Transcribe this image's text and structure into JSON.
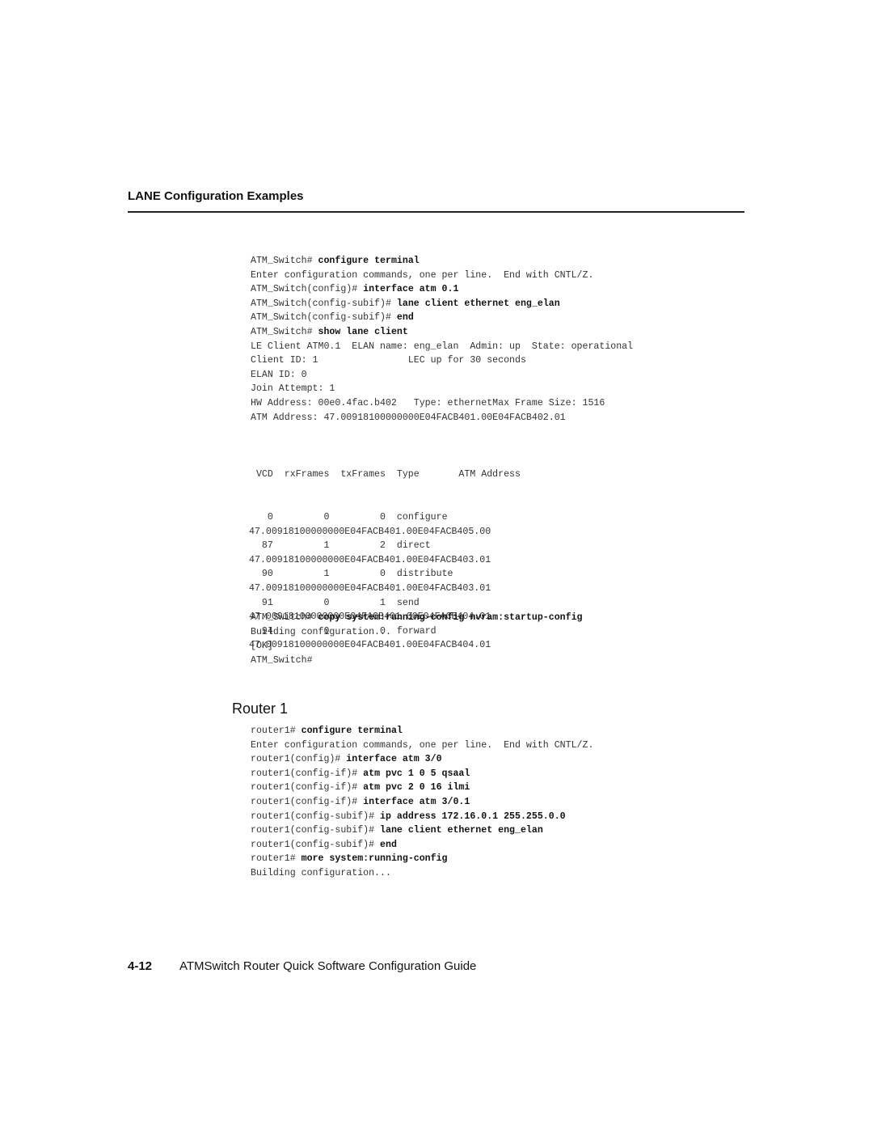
{
  "page": {
    "section_header": "LANE Configuration Examples",
    "switch_block": {
      "commands": [
        {
          "prompt": "ATM_Switch# ",
          "command": "configure terminal"
        },
        {
          "prompt": "Enter configuration commands, one per line.  End with CNTL/Z.",
          "command": ""
        },
        {
          "prompt": "ATM_Switch(config)# ",
          "command": "interface atm 0.1"
        },
        {
          "prompt": "ATM_Switch(config-subif)# ",
          "command": "lane client ethernet eng_elan"
        },
        {
          "prompt": "ATM_Switch(config-subif)# ",
          "command": "end"
        },
        {
          "prompt": "ATM_Switch# ",
          "command": "show lane client"
        },
        {
          "prompt": "LE Client ATM0.1  ELAN name: eng_elan  Admin: up  State: operational",
          "command": ""
        },
        {
          "prompt": "Client ID: 1                LEC up for 30 seconds",
          "command": ""
        },
        {
          "prompt": "ELAN ID: 0",
          "command": ""
        },
        {
          "prompt": "Join Attempt: 1",
          "command": ""
        },
        {
          "prompt": "HW Address: 00e0.4fac.b402   Type: ethernetMax Frame Size: 1516",
          "command": ""
        },
        {
          "prompt": "ATM Address: 47.00918100000000E04FACB401.00E04FACB402.01",
          "command": ""
        }
      ]
    },
    "vcd_table": {
      "header": " VCD  rxFrames  txFrames  Type       ATM Address",
      "rows": [
        {
          "vcd": "0",
          "rx": "0",
          "tx": "0",
          "type": "configure",
          "address": "47.00918100000000E04FACB401.00E04FACB405.00"
        },
        {
          "vcd": "87",
          "rx": "1",
          "tx": "2",
          "type": "direct",
          "address": "47.00918100000000E04FACB401.00E04FACB403.01"
        },
        {
          "vcd": "90",
          "rx": "1",
          "tx": "0",
          "type": "distribute",
          "address": "47.00918100000000E04FACB401.00E04FACB403.01"
        },
        {
          "vcd": "91",
          "rx": "0",
          "tx": "1",
          "type": "send",
          "address": "47.00918100000000E04FACB401.00E04FACB404.01"
        },
        {
          "vcd": "94",
          "rx": "0",
          "tx": "0",
          "type": "forward",
          "address": "47.00918100000000E04FACB401.00E04FACB404.01"
        }
      ]
    },
    "save_block": {
      "commands": [
        {
          "prompt": "ATM_Switch# ",
          "command": "copy system:running-config nvram:startup-config"
        },
        {
          "prompt": "Building configuration...",
          "command": ""
        },
        {
          "prompt": "[OK]",
          "command": ""
        },
        {
          "prompt": "ATM_Switch#",
          "command": ""
        }
      ]
    },
    "router_heading": "Router 1",
    "router_block": {
      "commands": [
        {
          "prompt": "router1# ",
          "command": "configure terminal"
        },
        {
          "prompt": "Enter configuration commands, one per line.  End with CNTL/Z.",
          "command": ""
        },
        {
          "prompt": "router1(config)# ",
          "command": "interface atm 3/0"
        },
        {
          "prompt": "router1(config-if)# ",
          "command": "atm pvc 1 0 5 qsaal"
        },
        {
          "prompt": "router1(config-if)# ",
          "command": "atm pvc 2 0 16 ilmi"
        },
        {
          "prompt": "router1(config-if)# ",
          "command": "interface atm 3/0.1"
        },
        {
          "prompt": "router1(config-subif)# ",
          "command": "ip address 172.16.0.1 255.255.0.0"
        },
        {
          "prompt": "router1(config-subif)# ",
          "command": "lane client ethernet eng_elan"
        },
        {
          "prompt": "router1(config-subif)# ",
          "command": "end"
        },
        {
          "prompt": "router1# ",
          "command": "more system:running-config"
        },
        {
          "prompt": "Building configuration...",
          "command": ""
        }
      ]
    },
    "footer": {
      "page_number": "4-12",
      "title": "ATMSwitch Router Quick Software Configuration Guide"
    }
  }
}
